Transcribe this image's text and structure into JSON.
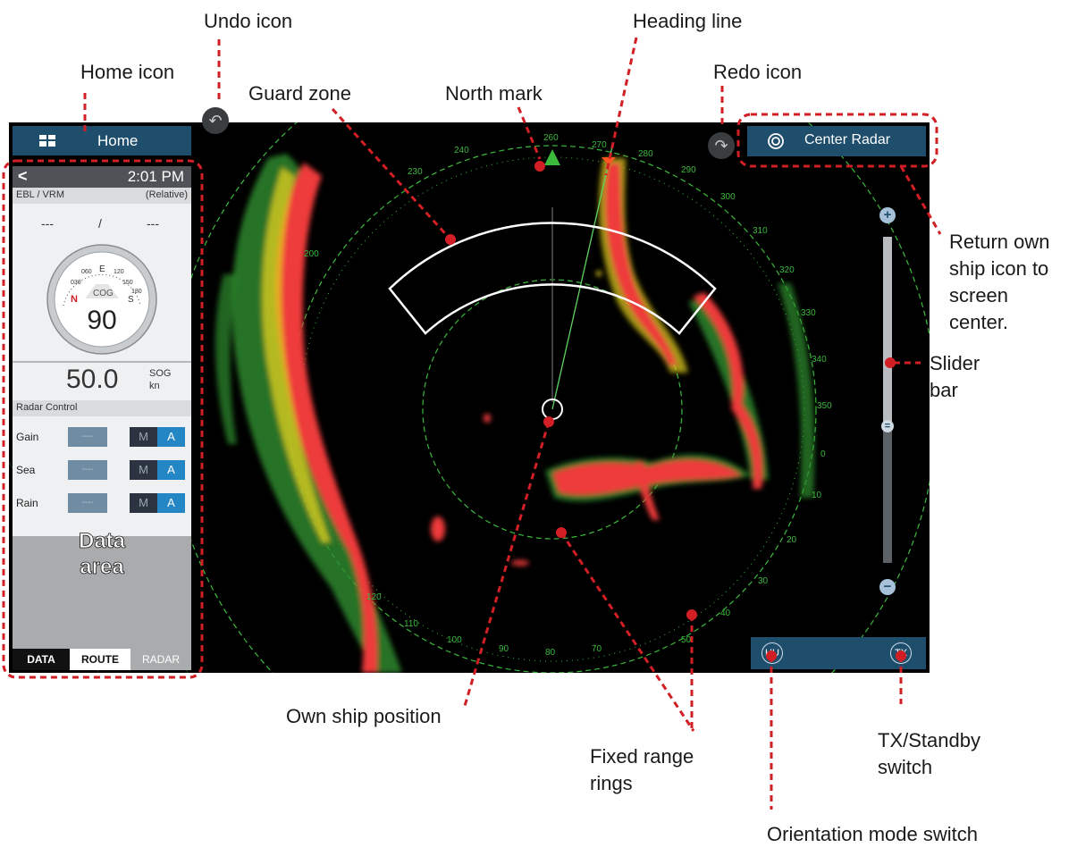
{
  "callouts": {
    "undo_icon": "Undo icon",
    "heading_line": "Heading line",
    "home_icon": "Home icon",
    "redo_icon": "Redo icon",
    "guard_zone": "Guard zone",
    "north_mark": "North mark",
    "return_line1": "Return own",
    "return_line2": "ship icon to",
    "return_line3": "screen",
    "return_line4": "center.",
    "slider_line1": "Slider",
    "slider_line2": "bar",
    "own_ship_position": "Own ship position",
    "fixed_line1": "Fixed range",
    "fixed_line2": "rings",
    "tx_line1": "TX/Standby",
    "tx_line2": "switch",
    "orientation_mode_switch": "Orientation mode switch",
    "data_line1": "Data",
    "data_line2": "area"
  },
  "home": {
    "label": "Home"
  },
  "data_panel": {
    "time": "2:01 PM",
    "back_icon": "chevron-left-icon",
    "ebl_vrm_label": "EBL / VRM",
    "relative_label": "(Relative)",
    "ebl_value": "---",
    "separator": "/",
    "vrm_value": "---",
    "compass": {
      "center_label": "COG",
      "value": "90",
      "n_label": "N",
      "e_label": "E",
      "s_label": "S",
      "ticks": [
        "030",
        "060",
        "120",
        "150",
        "180"
      ]
    },
    "sog_value": "50.0",
    "sog_label": "SOG",
    "sog_unit": "kn",
    "radar_control_label": "Radar Control",
    "controls": [
      {
        "label": "Gain",
        "value": "----",
        "m": "M",
        "a": "A"
      },
      {
        "label": "Sea",
        "value": "----",
        "m": "M",
        "a": "A"
      },
      {
        "label": "Rain",
        "value": "----",
        "m": "M",
        "a": "A"
      }
    ],
    "tabs": [
      "DATA",
      "ROUTE",
      "RADAR"
    ]
  },
  "center_radar": {
    "label": "Center Radar",
    "icon": "target-icon"
  },
  "bottom_bar": {
    "hu_label": "HU",
    "tx_label": "TX"
  },
  "slider": {
    "plus": "+",
    "minus": "−",
    "thumb": "="
  },
  "undo": {
    "icon": "undo-icon"
  },
  "redo": {
    "icon": "redo-icon"
  },
  "bearing_labels": [
    "260",
    "270",
    "280",
    "290",
    "300",
    "310",
    "320",
    "330",
    "340",
    "350",
    "0",
    "10",
    "20",
    "30",
    "40",
    "50",
    "70",
    "80",
    "90",
    "100",
    "110",
    "120",
    "200",
    "230",
    "240"
  ],
  "colors": {
    "radar_bg": "#000000",
    "echo_red": "#ee3a3a",
    "echo_yellow": "#e6d21e",
    "echo_green": "#2f8f2f",
    "ring_green": "#3cba3c",
    "panel_blue": "#1f4d6c",
    "accent_blue": "#2486c4",
    "callout_red": "#d11f25"
  }
}
